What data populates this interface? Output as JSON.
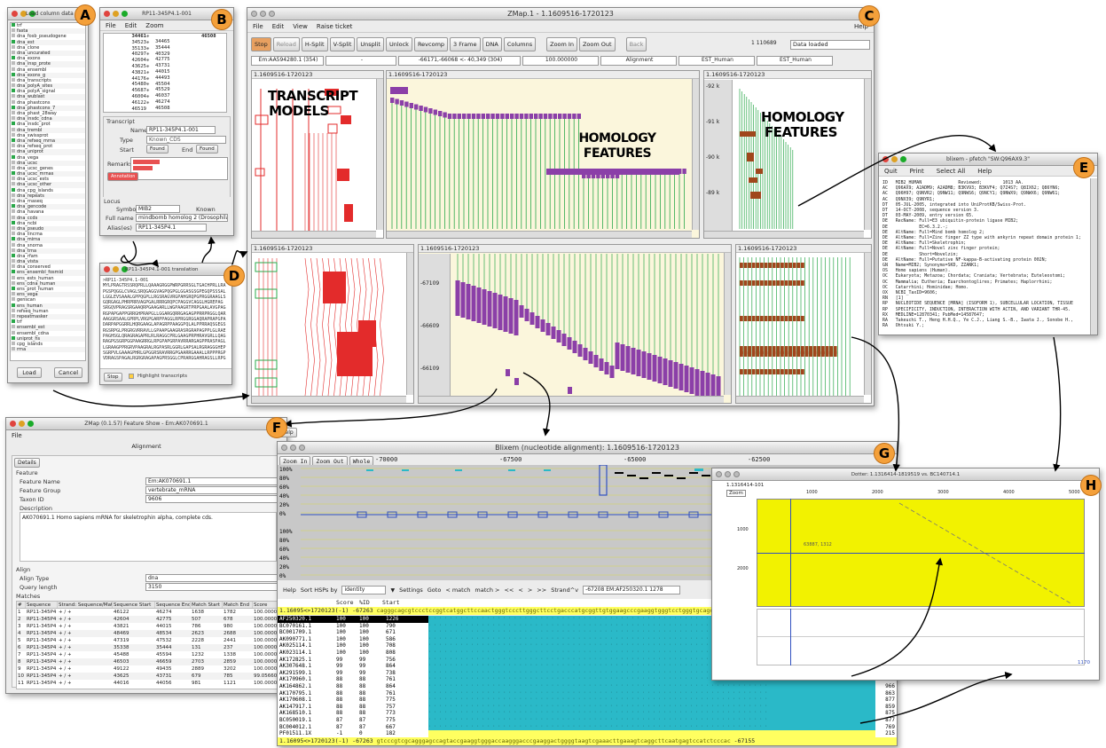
{
  "labels": {
    "A": "A",
    "B": "B",
    "C": "C",
    "D": "D",
    "E": "E",
    "F": "F",
    "G": "G",
    "H": "H"
  },
  "winA": {
    "title": "Load column data",
    "items": [
      "trf",
      "fasta",
      "dna_fosb_pseudogene",
      "dna_est",
      "dna_clone",
      "dna_uncurated",
      "dna_exons",
      "dna_insp_prote",
      "dna_ensembl",
      "dna_exons_g",
      "dna_transcripts",
      "dna_polyA_sites",
      "dna_polyA_signal",
      "dna_wublast",
      "dna_phastcons",
      "dna_phastcons_7",
      "dna_phast_28way",
      "dna_insdc_cdna",
      "dna_insdc_prot",
      "dna_trembl",
      "dna_swissprot",
      "dna_refseq_mrna",
      "dna_refseq_prot",
      "dna_uniprot",
      "dna_vega",
      "dna_ucsc",
      "dna_ucsc_genes",
      "dna_ucsc_mrnas",
      "dna_ucsc_ests",
      "dna_ucsc_other",
      "dna_cpg_islands",
      "dna_repeats",
      "dna_rnaseq",
      "dna_gencode",
      "dna_havana",
      "dna_ccds",
      "dna_ncbi",
      "dna_pseudo",
      "dna_lincrna",
      "dna_mirna",
      "dna_snorna",
      "dna_trna",
      "dna_rfam",
      "dna_vista",
      "dna_conserved",
      "ens_ensembl_fosmid",
      "ens_ests_human",
      "ens_cdna_human",
      "ens_prot_human",
      "ens_vega",
      "genscan",
      "ens_human",
      "refseq_human",
      "repeatmasker",
      "trf",
      "ensembl_est",
      "ensembl_cdna",
      "uniprot_hs",
      "cpg_islands",
      "rrna"
    ],
    "load": "Load",
    "cancel": "Cancel"
  },
  "winB": {
    "title": "RP11-345P4.1-001",
    "menu": [
      "File",
      "Edit",
      "Zoom"
    ],
    "nums_left": [
      "34461",
      "34523",
      "35133",
      "40297",
      "42604",
      "43625",
      "43821",
      "44176",
      "45480",
      "45687",
      "46004",
      "46122",
      "46519"
    ],
    "nums_right": [
      "34465",
      "35444",
      "40329",
      "42775",
      "43731",
      "44015",
      "44493",
      "45504",
      "45529",
      "46037",
      "46274",
      "46508"
    ],
    "right_num": "46508",
    "sec_transcript": "Transcript",
    "name_lbl": "Name",
    "name_val": "RP11-345P4.1-001",
    "type_lbl": "Type",
    "type_val": "Known_CDS",
    "start_lbl": "Start",
    "end_lbl": "End",
    "found": "Found",
    "remark_lbl": "Remarks",
    "remark_btn": "Annotation",
    "sec_locus": "Locus",
    "symbol_lbl": "Symbol",
    "symbol_val": "MIB2",
    "known_lbl": "Known",
    "fullname_lbl": "Full name",
    "fullname_val": "mindbomb homolog 2 (Drosophila)",
    "alias_lbl": "Alias(es)",
    "alias_val": "RP11-345P4.1",
    "locus_remark_lbl": "Remarks"
  },
  "winC": {
    "title": "ZMap.1 - 1.1609516-1720123",
    "menu": [
      "File",
      "Edit",
      "View",
      "Raise ticket"
    ],
    "help": "Help",
    "toolbar": [
      "Stop",
      "Reload",
      "H-Split",
      "V-Split",
      "Unsplit",
      "Unlock",
      "Revcomp",
      "3 Frame",
      "DNA",
      "Columns",
      "Zoom In",
      "Zoom Out",
      "Back"
    ],
    "coord": "1  110689",
    "status": "Data loaded",
    "info": [
      "Em:AA594280.1 (354)",
      "-",
      "-66171,-66068 <- 40,349 (304)",
      "100.000000",
      "Alignment",
      "EST_Human",
      "EST_Human"
    ],
    "pane_title": "1.1609516-1720123",
    "label_transcript": "TRANSCRIPT MODELS",
    "label_homology": "HOMOLOGY FEATURES",
    "label_homology2": "HOMOLOGY FEATURES",
    "scale_top": [
      "-92 k",
      "-91 k",
      "-90 k",
      "-89 k"
    ],
    "scale_bottom": [
      "-67109",
      "-66609",
      "-66109"
    ],
    "ruler_dots": "......"
  },
  "winD": {
    "title": "RP11-345P4.1-001 translation",
    "header": ">RP11-345P4.1-001",
    "lines": [
      "MYLPRAGTRSSRQPRLLQAAAGRGGPWRPGRRSGLTGACHPRLLRA",
      "PGSPQGGLCVAGLSRQGAGGVAGPQGPGLGGASGSGPEGQPSSSAL",
      "LGGLEVSAAALGPPQGPLLRGSRAGVRGPAHGRQPGPRGGRAAGLS",
      "GQRGAGLPHRPRRVAGPGALRRRGRQPCPAGGVCAGGLHGREPAG",
      "SRGQVPRAGSRGAAQRPGAAGARLLWGPAAGRTPRPGAALAVGPAG",
      "RGPAPGAPPGRRGHPRAPGLLGGARGQRRGAGAGPPRRPRGGLQAR",
      "AAGGRSAALGPRPLVRGPGARPPAGGLRPRGGRGGAQRAPRAPGPA",
      "DARPAPGGRRLHQRGAAGLAPAGRPPAAGGPQLALPPRRAQSGEGS",
      "RGSRPGLPRGRGVRRAVLLGPAAPGAAGRASRGRAPAGPPLGLRAE",
      "PAGHSGLQRAGRAGAPRLRLRAGGCPRLGAAGPRPHRAVGRLLQAG",
      "RAGPGSGRPGGPAAGRRGLRPGPAPGRPAVRRARGAGPPRASPAGL",
      "LGRAAGPPRGRVPAAGRALRGPASRLGGRLGAPSALRGRAGGGHEP",
      "SGRPVLGAAAGPHRLGPGGRSRAVRRGPGAARRGAAALLRPPPRGP",
      "VDRAGSPAGALRGRGRAGAPAGPRSGGLCPRARGGAHRAGSLLRPG"
    ],
    "stop_btn": "Stop",
    "highlight": "Highlight transcripts"
  },
  "winE": {
    "title": "blixem - pfetch \"SW:Q96AX9.3\"",
    "menu": [
      "Quit",
      "Print",
      "Select All",
      "Help"
    ],
    "lines": [
      "ID   MIB2_HUMAN              Reviewed;        1013 AA.",
      "AC   Q96AX9; A2ADM9; A2ADM8; B3KV93; B3KVF4; Q7Z4S7; Q8IX62; Q86YN6;",
      "AC   Q96H97; Q9NVR2; Q9NW11; Q9NWS6; Q9NCY1; Q9NWX9; Q9NWX6; Q9NW61;",
      "AC   Q9NX39; Q9NYR1;",
      "DT   05-JUL-2005, integrated into UniProtKB/Swiss-Prot.",
      "DT   14-OCT-2008, sequence version 3.",
      "DT   03-MAY-2009, entry version 65.",
      "DE   RecName: Full=E3 ubiquitin-protein ligase MIB2;",
      "DE            EC=6.3.2.-;",
      "DE   AltName: Full=Mind bomb homolog 2;",
      "DE   AltName: Full=Zinc finger ZZ type with ankyrin repeat domain protein 1;",
      "DE   AltName: Full=Skeletrophin;",
      "DE   AltName: Full=Novel zinc finger protein;",
      "DE            Short=Novelzin;",
      "DE   AltName: Full=Putative NF-kappa-B-activating protein 002N;",
      "GN   Name=MIB2; Synonyms=SKD, ZZANK1;",
      "OS   Homo sapiens (Human).",
      "OC   Eukaryota; Metazoa; Chordata; Craniata; Vertebrata; Euteleostomi;",
      "OC   Mammalia; Eutheria; Euarchontoglires; Primates; Haplorrhini;",
      "OC   Catarrhini; Hominidae; Homo.",
      "OX   NCBI_TaxID=9606;",
      "RN   [1]",
      "RP   NUCLEOTIDE SEQUENCE [MRNA] (ISOFORM 1), SUBCELLULAR LOCATION, TISSUE",
      "RP   SPECIFICITY, INDUCTION, INTERACTION WITH ACTIN, AND VARIANT THR-45.",
      "RX   MEDLINE=12870341; PubMed=14587647;",
      "RA   Takeuchi T., Heng H.H.Q., Ye C.J., Liang S.-B., Iwata J., Sonobe H.,",
      "RA   Ohtsuki Y.;"
    ]
  },
  "winF": {
    "title": "ZMap (0.1.57) Feature Show - Em:AK070691.1",
    "menu": "File",
    "tab": "Alignment",
    "details": "Details",
    "feature": "Feature",
    "fn_lbl": "Feature Name",
    "fn_val": "Em:AK070691.1",
    "fg_lbl": "Feature Group",
    "fg_val": "vertebrate_mRNA",
    "tax_lbl": "Taxon ID",
    "tax_val": "9606",
    "desc_lbl": "Description",
    "desc_val": "AK070691.1 Homo sapiens mRNA for skeletrophin alpha, complete cds.",
    "align_lbl": "Align",
    "at_lbl": "Align Type",
    "at_val": "dna",
    "ql_lbl": "Query length",
    "ql_val": "3150",
    "matches": "Matches",
    "cols": [
      "#",
      "Sequence",
      "Strand: Sequence/Match",
      "Sequence Start",
      "Sequence End",
      "Match Start",
      "Match End",
      "Score"
    ],
    "rows": [
      [
        "1",
        "RP11-345P4",
        "+ / +",
        "46122",
        "46274",
        "1638",
        "1782",
        "100.00000"
      ],
      [
        "2",
        "RP11-345P4",
        "+ / +",
        "42604",
        "42775",
        "507",
        "678",
        "100.00000"
      ],
      [
        "3",
        "RP11-345P4",
        "+ / +",
        "43821",
        "44015",
        "786",
        "980",
        "100.00000"
      ],
      [
        "4",
        "RP11-345P4",
        "+ / +",
        "48469",
        "48534",
        "2623",
        "2688",
        "100.00000"
      ],
      [
        "5",
        "RP11-345P4",
        "+ / +",
        "47319",
        "47532",
        "2228",
        "2441",
        "100.00000"
      ],
      [
        "6",
        "RP11-345P4",
        "+ / +",
        "35338",
        "35444",
        "131",
        "237",
        "100.00000"
      ],
      [
        "7",
        "RP11-345P4",
        "+ / +",
        "45488",
        "45594",
        "1232",
        "1338",
        "100.00000"
      ],
      [
        "8",
        "RP11-345P4",
        "+ / +",
        "46503",
        "46659",
        "2703",
        "2859",
        "100.00000"
      ],
      [
        "9",
        "RP11-345P4",
        "+ / +",
        "49122",
        "49435",
        "2889",
        "3202",
        "100.00000"
      ],
      [
        "10",
        "RP11-345P4",
        "+ / +",
        "43625",
        "43731",
        "679",
        "785",
        "99.05660"
      ],
      [
        "11",
        "RP11-345P4",
        "+ / +",
        "44016",
        "44056",
        "981",
        "1121",
        "100.00000"
      ]
    ],
    "help": "Help"
  },
  "winG": {
    "title": "Blixem  (nucleotide alignment):  1.1609516-1720123",
    "zoom_in": "Zoom In",
    "zoom_out": "Zoom Out",
    "whole": "Whole",
    "ticks": [
      "-70000",
      "-67500",
      "-65000",
      "-62500"
    ],
    "pct": [
      "100%",
      "80%",
      "60%",
      "40%",
      "20%",
      "0%"
    ],
    "help": "Help",
    "sort": "Sort HSPs by",
    "sort_val": "identity",
    "settings": "Settings",
    "goto": "Goto",
    "nav": [
      "< match",
      "match >",
      "<<",
      "<",
      ">",
      ">>"
    ],
    "strand": "Strand^v",
    "pos": "-67208  EM:AF250320.1  1278",
    "hdr": [
      "Score",
      "%ID",
      "Start"
    ],
    "ref_top": "1.16095<>1720123(-1)   -67263",
    "ref_bot": "1.16095<>1720123(-1)   -67263",
    "ref_end": "-67155",
    "rows": [
      [
        "AF250320.1",
        "100",
        "100",
        "1226",
        "1392"
      ],
      [
        "BC070161.1",
        "100",
        "100",
        "790",
        "956"
      ],
      [
        "BC001709.1",
        "100",
        "100",
        "671",
        "773"
      ],
      [
        "AK090771.1",
        "100",
        "100",
        "586",
        "685"
      ],
      [
        "AK025114.1",
        "100",
        "100",
        "708",
        "910"
      ],
      [
        "AK023114.1",
        "100",
        "100",
        "808",
        "858"
      ],
      [
        "AK172825.1",
        "99",
        "99",
        "756",
        "820"
      ],
      [
        "AK307648.1",
        "99",
        "99",
        "864",
        "966"
      ],
      [
        "AK291599.1",
        "99",
        "99",
        "738",
        "834"
      ],
      [
        "AK170960.1",
        "88",
        "88",
        "761",
        "863"
      ],
      [
        "AK164862.1",
        "88",
        "88",
        "864",
        "966"
      ],
      [
        "AK170795.1",
        "88",
        "88",
        "761",
        "863"
      ],
      [
        "AK170608.1",
        "88",
        "88",
        "775",
        "877"
      ],
      [
        "AK147917.1",
        "88",
        "88",
        "757",
        "859"
      ],
      [
        "AK168510.1",
        "88",
        "88",
        "773",
        "875"
      ],
      [
        "BC050019.1",
        "87",
        "87",
        "775",
        "877"
      ],
      [
        "BC004012.1",
        "87",
        "87",
        "667",
        "769"
      ],
      [
        "PF01511.1X",
        "-1",
        "0",
        "182",
        "215"
      ]
    ]
  },
  "winH": {
    "title": "Dotter: 1.1316414-1819519 vs. BC140714.1",
    "coord": "1.1316414-101",
    "zoom": "Zoom",
    "ticks": [
      "1000",
      "2000",
      "3000",
      "4000",
      "5000"
    ],
    "yticks": [
      "1000",
      "2000"
    ],
    "label": "63887, 1312",
    "corner": "1170"
  },
  "colors": {
    "badge": "#f4a03a",
    "red": "#e32b2b",
    "purple": "#8b3fa8",
    "brown": "#a0461c",
    "green": "#2aa84a",
    "cream": "#fbf6dc",
    "yellow": "#f5f500",
    "cyan": "#2ab9c8"
  }
}
